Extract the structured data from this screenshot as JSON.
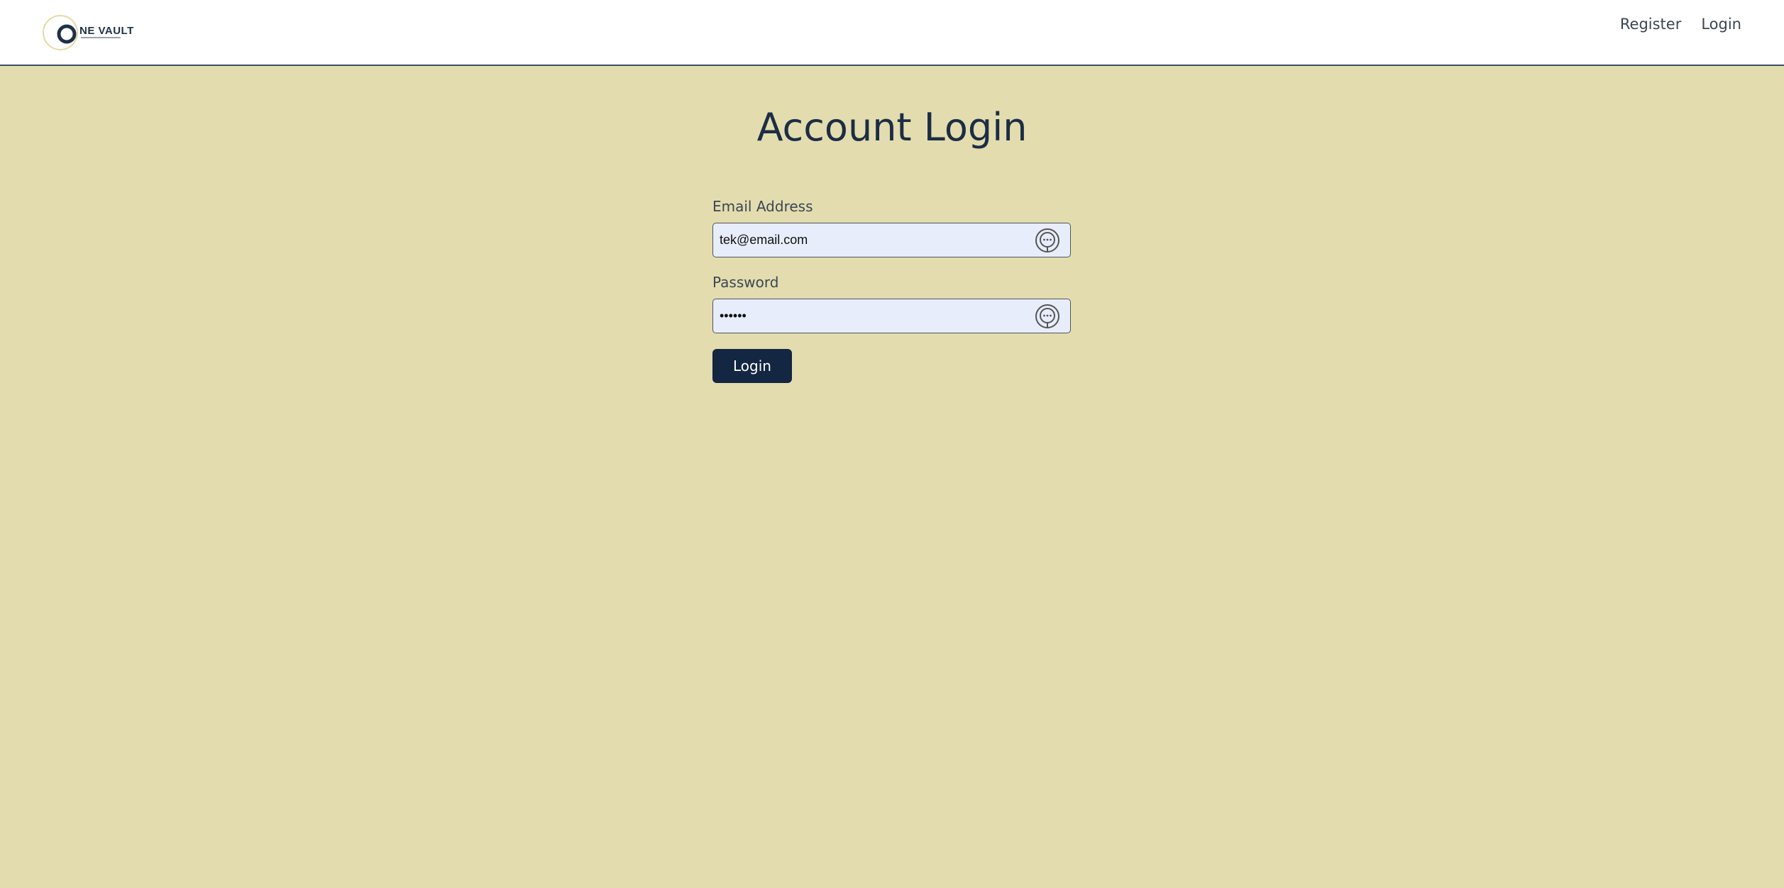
{
  "brand": {
    "logo_text": "NE VAULT",
    "logo_icon": "one-vault-logo-icon"
  },
  "nav": {
    "register_label": "Register",
    "login_label": "Login"
  },
  "page": {
    "title": "Account Login"
  },
  "form": {
    "email_label": "Email Address",
    "email_value": "tek@email.com",
    "password_label": "Password",
    "password_value": "••••••",
    "password_manager_icon": "password-manager-icon",
    "submit_label": "Login"
  },
  "colors": {
    "background": "#e3dcae",
    "primary": "#132642",
    "input_fill": "#e8edfb"
  }
}
